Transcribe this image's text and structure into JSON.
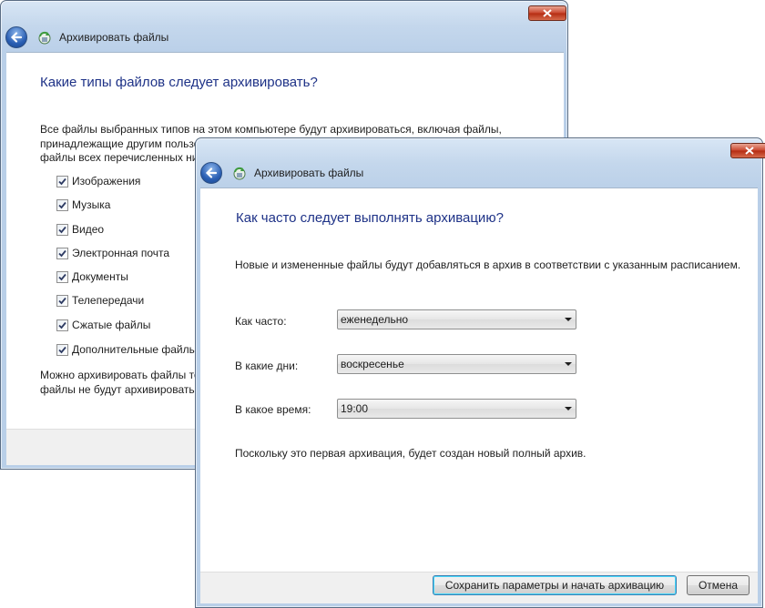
{
  "back_window": {
    "title": "Архивировать файлы",
    "heading": "Какие типы файлов следует архивировать?",
    "intro_lines": [
      "Все файлы выбранных типов на этом компьютере будут архивироваться, включая файлы,",
      "принадлежащие другим пользо",
      "файлы всех перечисленных ни"
    ],
    "file_types": [
      {
        "label": "Изображения",
        "checked": true
      },
      {
        "label": "Музыка",
        "checked": true
      },
      {
        "label": "Видео",
        "checked": true
      },
      {
        "label": "Электронная почта",
        "checked": true
      },
      {
        "label": "Документы",
        "checked": true
      },
      {
        "label": "Телепередачи",
        "checked": true
      },
      {
        "label": "Сжатые файлы",
        "checked": true
      },
      {
        "label": "Дополнительные файлы",
        "checked": true
      }
    ],
    "note_lines": [
      "Можно архивировать файлы то",
      "файлы не будут архивироватьс"
    ]
  },
  "front_window": {
    "title": "Архивировать файлы",
    "heading": "Как часто следует выполнять архивацию?",
    "description": "Новые и измененные файлы будут добавляться в архив в соответствии с указанным расписанием.",
    "fields": [
      {
        "label": "Как часто:",
        "value": "еженедельно"
      },
      {
        "label": "В какие дни:",
        "value": "воскресенье"
      },
      {
        "label": "В какое время:",
        "value": "19:00"
      }
    ],
    "info": "Поскольку это первая архивация, будет создан новый полный архив.",
    "save_button": "Сохранить параметры и начать архивацию",
    "cancel_button": "Отмена"
  },
  "icons": {
    "back": "back-arrow-icon",
    "app": "backup-icon",
    "close": "close-icon",
    "check": "checkmark-icon",
    "dropdown": "chevron-down-icon"
  },
  "colors": {
    "heading": "#1e3287",
    "frame": "#c4d7ec",
    "close_button": "#c9452c",
    "footer": "#f0f0f0"
  }
}
